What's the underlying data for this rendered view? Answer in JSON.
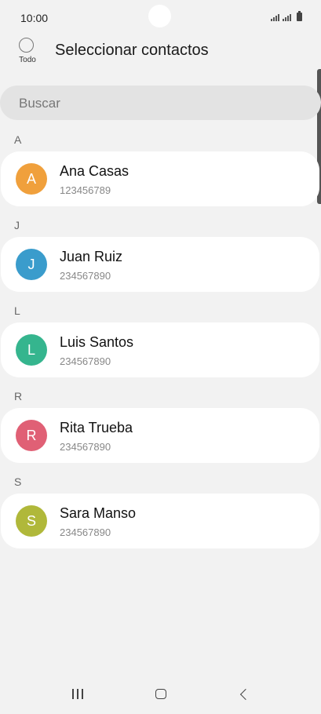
{
  "status_bar": {
    "time": "10:00"
  },
  "header": {
    "select_all_label": "Todo",
    "title": "Seleccionar contactos"
  },
  "search": {
    "placeholder": "Buscar"
  },
  "sections": [
    {
      "letter": "A",
      "contact": {
        "name": "Ana Casas",
        "phone": "123456789",
        "initial": "A",
        "color": "#f0a03c"
      }
    },
    {
      "letter": "J",
      "contact": {
        "name": "Juan Ruiz",
        "phone": "234567890",
        "initial": "J",
        "color": "#3a9ccc"
      }
    },
    {
      "letter": "L",
      "contact": {
        "name": "Luis Santos",
        "phone": "234567890",
        "initial": "L",
        "color": "#35b58e"
      }
    },
    {
      "letter": "R",
      "contact": {
        "name": "Rita Trueba",
        "phone": "234567890",
        "initial": "R",
        "color": "#e06075"
      }
    },
    {
      "letter": "S",
      "contact": {
        "name": "Sara Manso",
        "phone": "234567890",
        "initial": "S",
        "color": "#b0b83a"
      }
    }
  ],
  "nav_icons": [
    "recent-apps-icon",
    "home-icon",
    "back-icon"
  ]
}
